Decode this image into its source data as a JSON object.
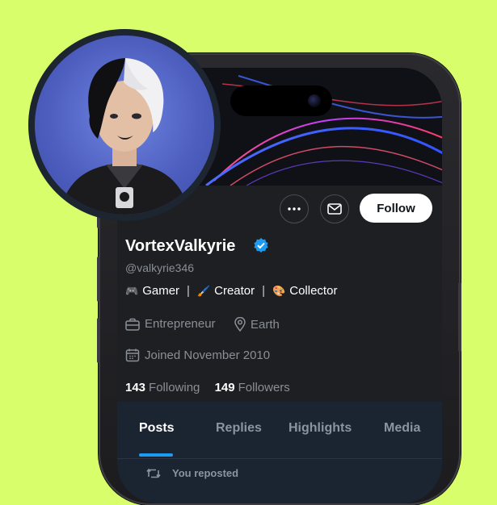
{
  "profile": {
    "display_name": "VortexValkyrie",
    "handle": "@valkyrie346",
    "verified": true,
    "tags": [
      {
        "emoji": "🎮",
        "label": "Gamer"
      },
      {
        "emoji": "🖌️",
        "label": "Creator"
      },
      {
        "emoji": "🎨",
        "label": "Collector"
      }
    ],
    "occupation": "Entrepreneur",
    "location": "Earth",
    "joined": "Joined November 2010",
    "following_count": "143",
    "following_label": "Following",
    "followers_count": "149",
    "followers_label": "Followers"
  },
  "actions": {
    "more_icon": "more-horizontal-icon",
    "message_icon": "mail-icon",
    "follow_label": "Follow"
  },
  "tabs": [
    {
      "label": "Posts",
      "active": true
    },
    {
      "label": "Replies",
      "active": false
    },
    {
      "label": "Highlights",
      "active": false
    },
    {
      "label": "Media",
      "active": false
    }
  ],
  "feed": {
    "repost_icon": "repost-icon",
    "repost_text": "You reposted"
  },
  "colors": {
    "background": "#d8ff6b",
    "screen": "#1e1f22",
    "accent": "#1d9bf0",
    "follow_bg": "#ffffff"
  }
}
